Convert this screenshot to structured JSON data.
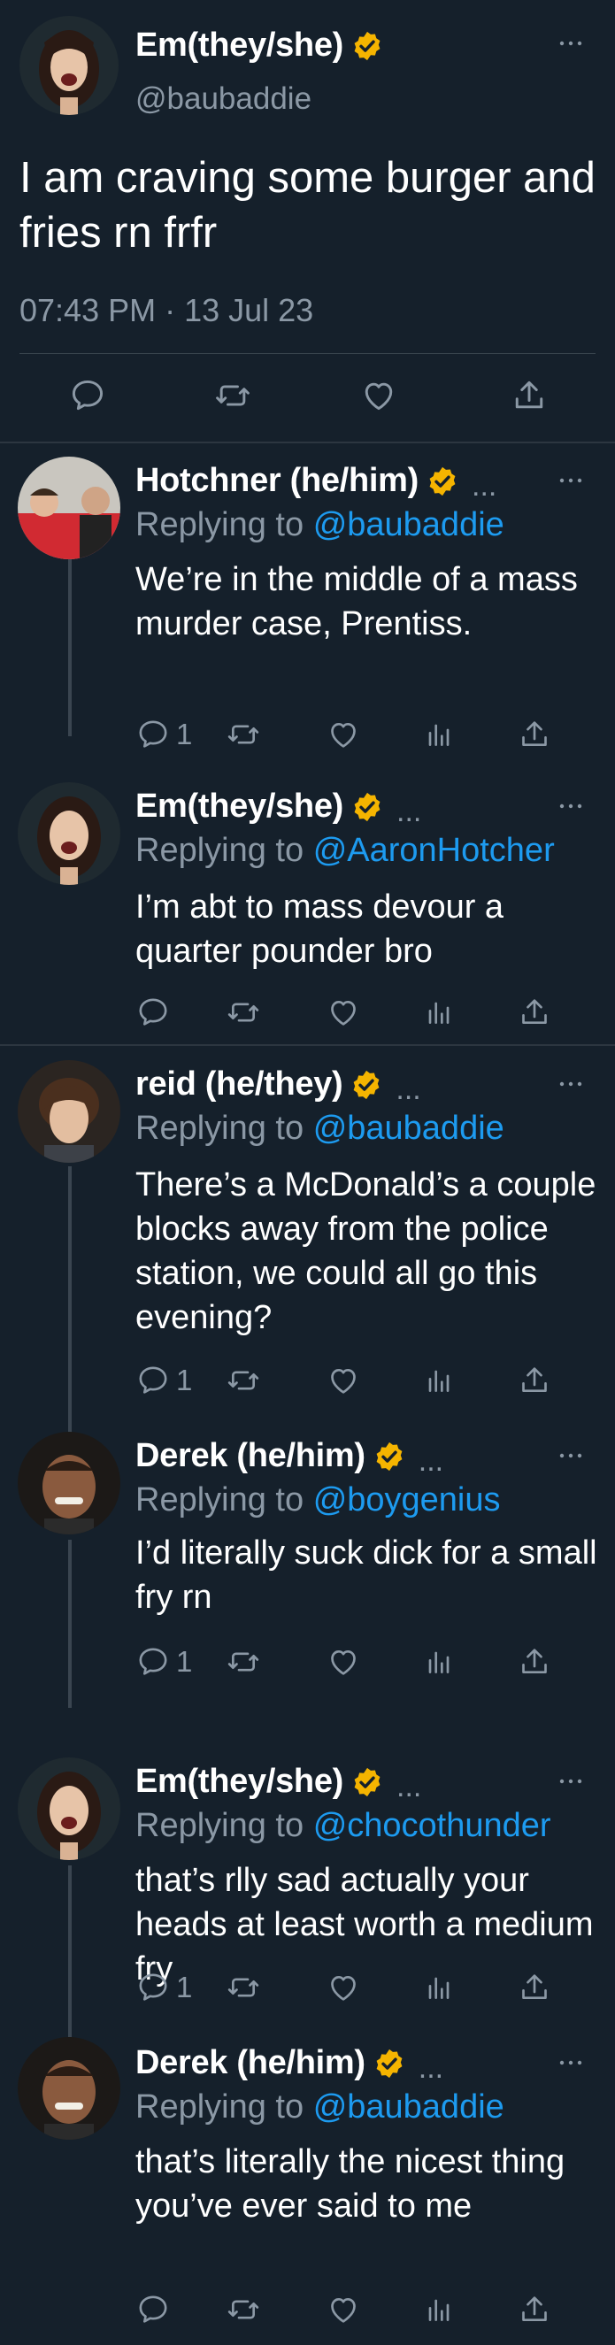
{
  "main_tweet": {
    "name": "Em(they/she)",
    "handle": "@baubaddie",
    "text": "I am craving some burger and fries rn frfr",
    "timestamp": "07:43 PM · 13 Jul 23",
    "more": "···"
  },
  "replying_label": "Replying to",
  "replies": [
    {
      "name": "Hotchner (he/him)",
      "inline_dots": "...",
      "mention": "@baubaddie",
      "text": "We’re in the middle of a mass murder case, Prentiss.",
      "reply_count": "1",
      "more": "···"
    },
    {
      "name": "Em(they/she)",
      "inline_dots": "...",
      "mention": "@AaronHotcher",
      "text": "I’m abt to mass devour a quarter pounder bro",
      "reply_count": "",
      "more": "···"
    },
    {
      "name": "reid (he/they)",
      "inline_dots": "...",
      "mention": "@baubaddie",
      "text": "There’s a McDonald’s a couple blocks away from the police station, we could all go this evening?",
      "reply_count": "1",
      "more": "···"
    },
    {
      "name": "Derek (he/him)",
      "inline_dots": "...",
      "mention": "@boygenius",
      "text": "I’d literally suck dick for a small fry rn",
      "reply_count": "1",
      "more": "···"
    },
    {
      "name": "Em(they/she)",
      "inline_dots": "...",
      "mention": "@chocothunder",
      "text": "that’s rlly sad actually your heads at least worth a medium fry",
      "reply_count": "1",
      "more": "···"
    },
    {
      "name": "Derek (he/him)",
      "inline_dots": "...",
      "mention": "@baubaddie",
      "text": "that’s literally the nicest thing you’ve ever said to me",
      "reply_count": "",
      "more": "···"
    }
  ],
  "colors": {
    "background": "#15202b",
    "secondary_text": "#8b98a5",
    "link": "#1d9bf0",
    "verified": "#f5b400",
    "divider": "#38444d"
  },
  "icons": [
    "comment-icon",
    "retweet-icon",
    "like-icon",
    "share-icon",
    "analytics-icon",
    "verified-badge-icon",
    "more-icon"
  ]
}
